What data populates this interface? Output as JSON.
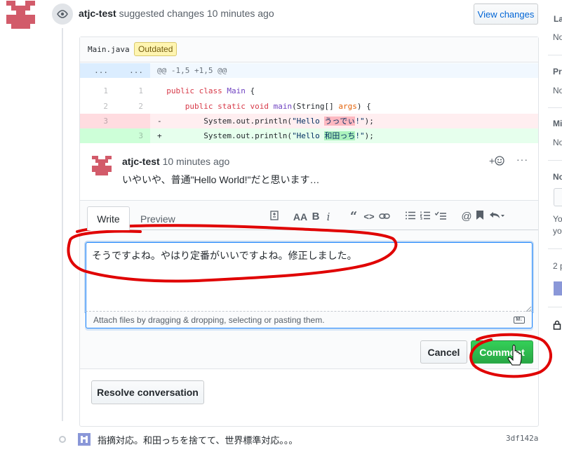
{
  "review": {
    "author": "atjc-test",
    "action_text": "suggested changes 10 minutes ago",
    "view_changes_label": "View changes"
  },
  "file": {
    "name": "Main.java",
    "badge": "Outdated"
  },
  "diff": {
    "hunk_left": "...",
    "hunk_right": "...",
    "hunk_header": "@@ -1,5 +1,5 @@",
    "lines": [
      {
        "type": "context",
        "old": "1",
        "new": "1",
        "sign": " ",
        "code": "public class Main {"
      },
      {
        "type": "context",
        "old": "2",
        "new": "2",
        "sign": " ",
        "code": "    public static void main(String[] args) {"
      },
      {
        "type": "del",
        "old": "3",
        "new": "",
        "sign": "-",
        "code": "        System.out.println(\"Hello うっでぃ!\");"
      },
      {
        "type": "add",
        "old": "",
        "new": "3",
        "sign": "+",
        "code": "        System.out.println(\"Hello 和田っち!\");"
      }
    ]
  },
  "comment": {
    "author": "atjc-test",
    "time": "10 minutes ago",
    "body": "いやいや、普通\"Hello World!\"だと思います…"
  },
  "reply": {
    "tab_write": "Write",
    "tab_preview": "Preview",
    "text": "そうですよね。やはり定番がいいですよね。修正しました。",
    "attach_hint": "Attach files by dragging & dropping, selecting or pasting them.",
    "cancel_label": "Cancel",
    "comment_label": "Comment"
  },
  "resolve_label": "Resolve conversation",
  "commit": {
    "message": "指摘対応。和田っちを捨てて、世界標準対応。。。",
    "sha": "3df142a"
  },
  "sidebar": {
    "items": [
      "La",
      "No",
      "Pr",
      "No",
      "Mi",
      "No",
      "No",
      "Yo",
      "yo",
      "2 p"
    ]
  },
  "colors": {
    "annotation": "#e00000",
    "primary_green": "#28a745",
    "link_blue": "#0366d6"
  }
}
